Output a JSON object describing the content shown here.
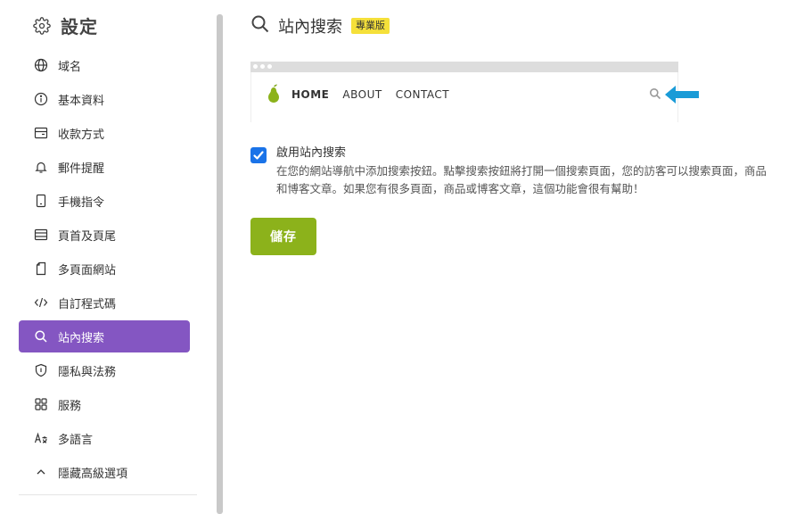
{
  "sidebar": {
    "title": "設定",
    "items": [
      {
        "label": "域名",
        "icon": "globe-icon"
      },
      {
        "label": "基本資料",
        "icon": "info-icon"
      },
      {
        "label": "收款方式",
        "icon": "wallet-icon"
      },
      {
        "label": "郵件提醒",
        "icon": "bell-icon"
      },
      {
        "label": "手機指令",
        "icon": "mobile-icon"
      },
      {
        "label": "頁首及頁尾",
        "icon": "layout-icon"
      },
      {
        "label": "多頁面網站",
        "icon": "pages-icon"
      },
      {
        "label": "自訂程式碼",
        "icon": "code-icon"
      },
      {
        "label": "站內搜索",
        "icon": "search-icon",
        "active": true
      },
      {
        "label": "隱私與法務",
        "icon": "shield-icon"
      },
      {
        "label": "服務",
        "icon": "grid-icon"
      },
      {
        "label": "多語言",
        "icon": "language-icon"
      },
      {
        "label": "隱藏高級選項",
        "icon": "chevron-up-icon"
      }
    ]
  },
  "main": {
    "title": "站內搜索",
    "badge": "專業版",
    "preview": {
      "nav": [
        "HOME",
        "ABOUT",
        "CONTACT"
      ]
    },
    "option": {
      "checked": true,
      "label": "啟用站內搜索",
      "description": "在您的網站導航中添加搜索按鈕。點擊搜索按鈕將打開一個搜索頁面，您的訪客可以搜索頁面，商品和博客文章。如果您有很多頁面，商品或博客文章，這個功能會很有幫助！"
    },
    "save_label": "儲存"
  },
  "colors": {
    "active": "#8456c2",
    "save": "#8cb21b",
    "badge": "#f5e03a",
    "checkbox": "#1a73e8",
    "arrow": "#1a9bd7"
  }
}
